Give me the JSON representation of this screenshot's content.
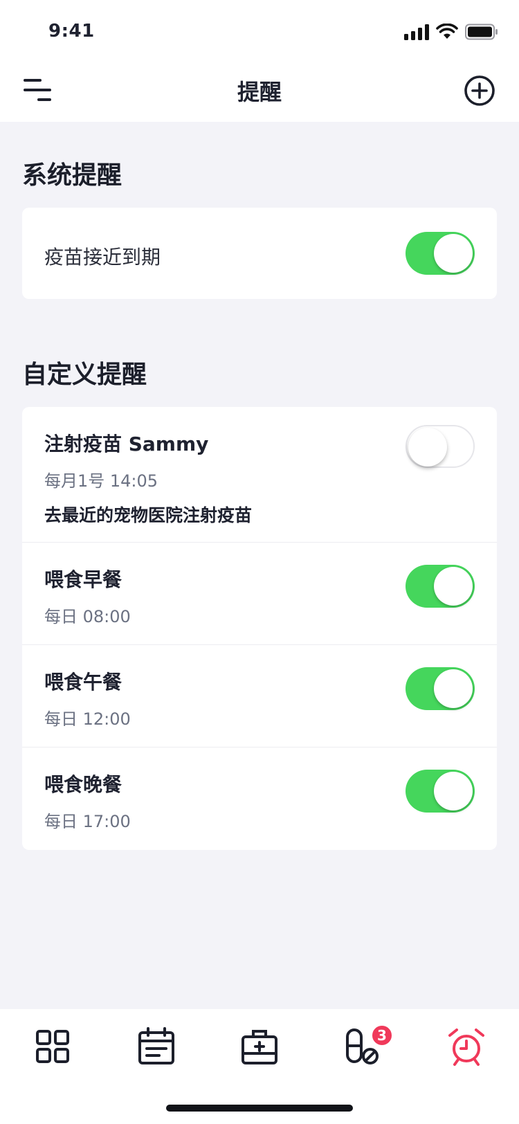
{
  "status_bar": {
    "time": "9:41"
  },
  "nav": {
    "title": "提醒"
  },
  "system_section": {
    "title": "系统提醒",
    "items": [
      {
        "label": "疫苗接近到期",
        "enabled": true
      }
    ]
  },
  "custom_section": {
    "title": "自定义提醒",
    "items": [
      {
        "title": "注射疫苗 Sammy",
        "schedule": "每月1号 14:05",
        "note": "去最近的宠物医院注射疫苗",
        "enabled": false
      },
      {
        "title": "喂食早餐",
        "schedule": "每日 08:00",
        "enabled": true
      },
      {
        "title": "喂食午餐",
        "schedule": "每日 12:00",
        "enabled": true
      },
      {
        "title": "喂食晚餐",
        "schedule": "每日 17:00",
        "enabled": true
      }
    ]
  },
  "tabbar": {
    "tabs": [
      {
        "icon": "grid-icon",
        "active": false
      },
      {
        "icon": "calendar-icon",
        "active": false
      },
      {
        "icon": "medical-kit-icon",
        "active": false
      },
      {
        "icon": "pill-icon",
        "active": false,
        "badge": "3"
      },
      {
        "icon": "alarm-clock-icon",
        "active": true
      }
    ]
  },
  "colors": {
    "accent": "#f0395a",
    "toggle_on": "#45d65c",
    "background": "#f3f3f8",
    "text_dark": "#1f2230",
    "text_muted": "#6b7182"
  }
}
